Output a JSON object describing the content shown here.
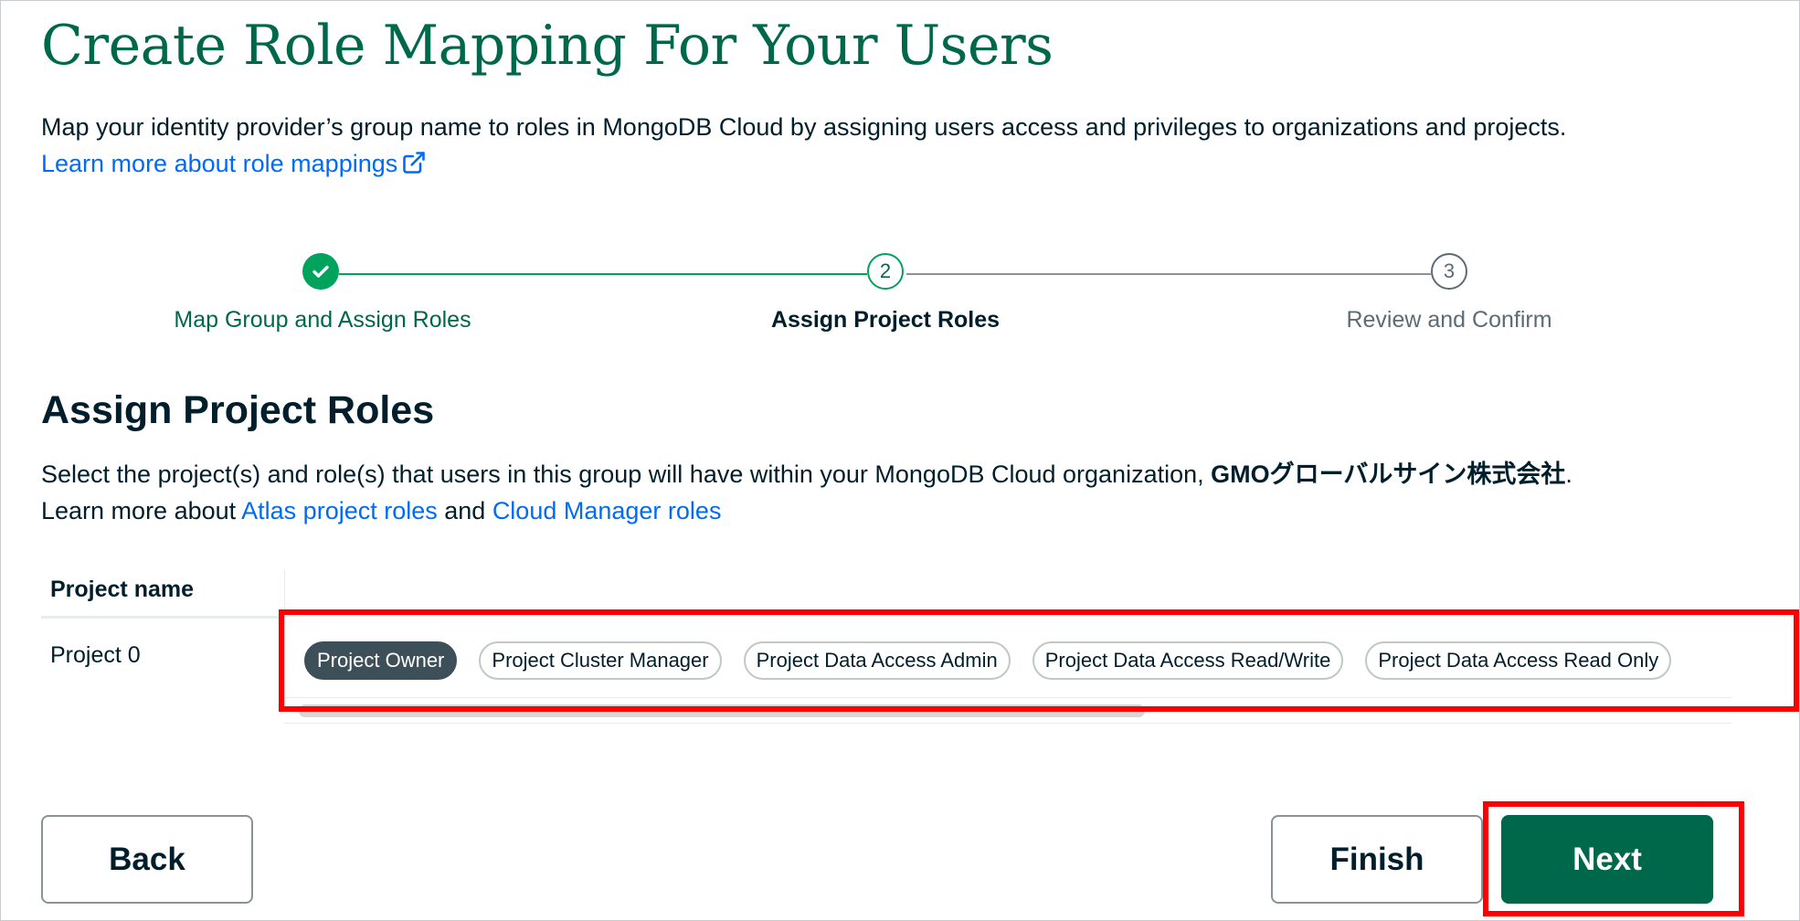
{
  "page": {
    "title": "Create Role Mapping For Your Users",
    "intro_text": "Map your identity provider’s group name to roles in MongoDB Cloud by assigning users access and privileges to organizations and projects.",
    "learn_more_link": "Learn more about role mappings"
  },
  "stepper": {
    "steps": [
      {
        "label": "Map Group and Assign Roles",
        "status": "complete"
      },
      {
        "number": "2",
        "label": "Assign Project Roles",
        "status": "current"
      },
      {
        "number": "3",
        "label": "Review and Confirm",
        "status": "upcoming"
      }
    ]
  },
  "section": {
    "title": "Assign Project Roles",
    "desc_prefix": "Select the project(s) and role(s) that users in this group will have within your MongoDB Cloud organization, ",
    "org_name": "GMOグローバルサイン株式会社",
    "desc_period": ".",
    "learn_prefix": "Learn more about ",
    "atlas_link": "Atlas project roles",
    "and_text": " and ",
    "cloud_link": "Cloud Manager roles"
  },
  "table": {
    "column_header": "Project name",
    "rows": [
      {
        "project": "Project 0",
        "roles": [
          {
            "label": "Project Owner",
            "selected": true
          },
          {
            "label": "Project Cluster Manager",
            "selected": false
          },
          {
            "label": "Project Data Access Admin",
            "selected": false
          },
          {
            "label": "Project Data Access Read/Write",
            "selected": false
          },
          {
            "label": "Project Data Access Read Only",
            "selected": false
          }
        ]
      }
    ]
  },
  "buttons": {
    "back": "Back",
    "finish": "Finish",
    "next": "Next"
  },
  "colors": {
    "brand_green": "#00684a",
    "step_green": "#00a35c",
    "link_blue": "#016bf8",
    "highlight_red": "#ff0000",
    "selected_chip": "#3d4f58"
  }
}
